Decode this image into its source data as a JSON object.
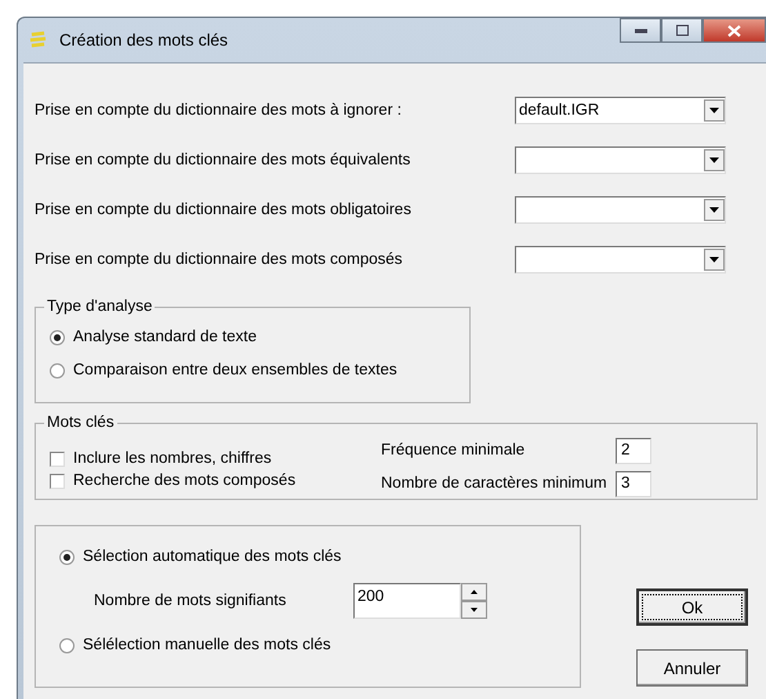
{
  "window": {
    "title": "Création des mots clés"
  },
  "dictionaries": [
    {
      "label": "Prise en compte du dictionnaire des mots à ignorer :",
      "value": "default.IGR"
    },
    {
      "label": "Prise en compte du dictionnaire des mots équivalents"
    },
    {
      "label": "Prise en compte du dictionnaire des mots obligatoires"
    },
    {
      "label": "Prise en compte du dictionnaire des mots composés"
    }
  ],
  "analysis_type": {
    "title": "Type d'analyse",
    "options": [
      {
        "label": "Analyse standard de texte",
        "selected": true
      },
      {
        "label": "Comparaison entre deux ensembles de textes",
        "selected": false
      }
    ]
  },
  "keywords": {
    "title": "Mots clés",
    "checkboxes": [
      {
        "label": "Inclure les nombres, chiffres",
        "checked": false
      },
      {
        "label": "Recherche des mots composés",
        "checked": false
      }
    ],
    "fields": [
      {
        "label": "Fréquence minimale",
        "value": "2"
      },
      {
        "label": "Nombre de caractères minimum",
        "value": "3"
      }
    ]
  },
  "selection": {
    "options": [
      {
        "label": "Sélection automatique des mots clés",
        "selected": true
      },
      {
        "label": "Sélélection manuelle des mots clés",
        "selected": false
      }
    ],
    "count": {
      "label": "Nombre de mots signifiants",
      "value": "200"
    }
  },
  "buttons": [
    {
      "label": "Ok",
      "default": true
    },
    {
      "label": "Annuler",
      "default": false
    }
  ]
}
